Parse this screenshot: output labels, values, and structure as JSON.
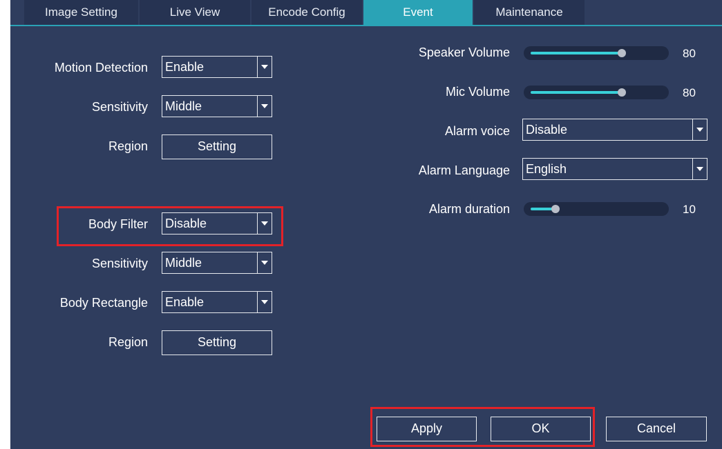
{
  "tabs": [
    {
      "label": "Image Setting"
    },
    {
      "label": "Live View"
    },
    {
      "label": "Encode Config"
    },
    {
      "label": "Event"
    },
    {
      "label": "Maintenance"
    }
  ],
  "active_tab": "Event",
  "left": {
    "motion_detection": {
      "label": "Motion Detection",
      "value": "Enable"
    },
    "sensitivity1": {
      "label": "Sensitivity",
      "value": "Middle"
    },
    "region1": {
      "label": "Region",
      "button": "Setting"
    },
    "body_filter": {
      "label": "Body Filter",
      "value": "Disable"
    },
    "sensitivity2": {
      "label": "Sensitivity",
      "value": "Middle"
    },
    "body_rectangle": {
      "label": "Body Rectangle",
      "value": "Enable"
    },
    "region2": {
      "label": "Region",
      "button": "Setting"
    }
  },
  "right": {
    "speaker_volume": {
      "label": "Speaker Volume",
      "value": "80",
      "level": 0.8
    },
    "mic_volume": {
      "label": "Mic Volume",
      "value": "80",
      "level": 0.8
    },
    "alarm_voice": {
      "label": "Alarm voice",
      "value": "Disable"
    },
    "alarm_language": {
      "label": "Alarm Language",
      "value": "English"
    },
    "alarm_duration": {
      "label": "Alarm duration",
      "value": "10",
      "level": 0.22
    }
  },
  "footer": {
    "apply": "Apply",
    "ok": "OK",
    "cancel": "Cancel"
  },
  "colors": {
    "background": "#2f3d5e",
    "accent": "#2aa3b6",
    "highlight": "#e32228",
    "slider_fill": "#39d0d8"
  }
}
